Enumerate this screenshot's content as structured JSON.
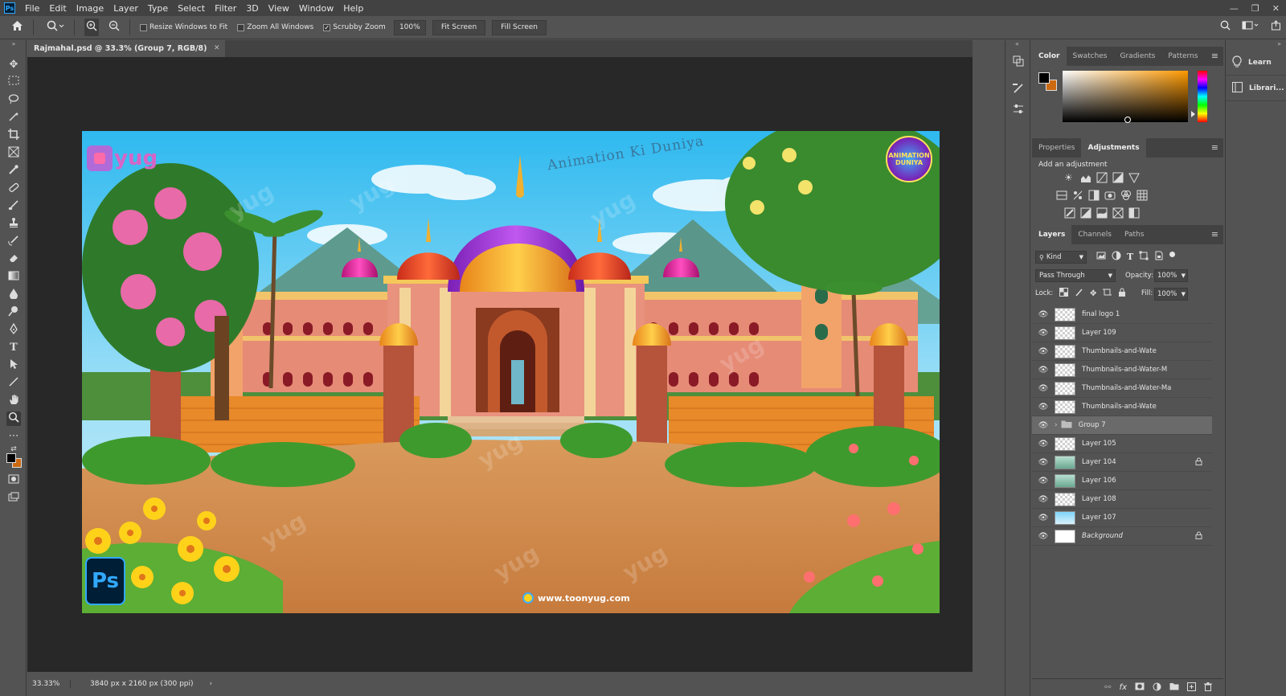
{
  "app": {
    "logo": "Ps",
    "menu": [
      "File",
      "Edit",
      "Image",
      "Layer",
      "Type",
      "Select",
      "Filter",
      "3D",
      "View",
      "Window",
      "Help"
    ],
    "window_controls": [
      "minimize-icon",
      "restore-icon",
      "close-icon"
    ]
  },
  "options": {
    "resize_windows": "Resize Windows to Fit",
    "zoom_all": "Zoom All Windows",
    "scrubby_zoom": "Scrubby Zoom",
    "zoom_value": "100%",
    "fit_screen": "Fit Screen",
    "fill_screen": "Fill Screen",
    "resize_checked": false,
    "zoom_all_checked": false,
    "scrubby_checked": true
  },
  "document": {
    "tab_title": "Rajmahal.psd @ 33.3% (Group 7, RGB/8)",
    "zoom": "33.33%",
    "doc_info": "3840 px x 2160 px (300 ppi)"
  },
  "artwork": {
    "watermark_title": "Animation Ki Duniya",
    "brand_logo": "yug",
    "corner_badge": "ANIMATION DUNIYA",
    "ps_badge": "Ps",
    "website": "www.toonyug.com"
  },
  "color_panel": {
    "tabs": [
      "Color",
      "Swatches",
      "Gradients",
      "Patterns"
    ],
    "foreground": "#000000",
    "background": "#cc6a12",
    "hue_base": "#ff9900"
  },
  "adjustments_panel": {
    "tabs": [
      "Properties",
      "Adjustments"
    ],
    "label": "Add an adjustment"
  },
  "layers_panel": {
    "tabs": [
      "Layers",
      "Channels",
      "Paths"
    ],
    "kind_label": "Kind",
    "blend_mode": "Pass Through",
    "opacity_label": "Opacity:",
    "opacity_value": "100%",
    "lock_label": "Lock:",
    "fill_label": "Fill:",
    "fill_value": "100%",
    "layers": [
      {
        "name": "final logo 1",
        "thumb": "check"
      },
      {
        "name": "Layer 109",
        "thumb": "check"
      },
      {
        "name": "Thumbnails-and-Wate",
        "thumb": "check"
      },
      {
        "name": "Thumbnails-and-Water-M",
        "thumb": "check"
      },
      {
        "name": "Thumbnails-and-Water-Ma",
        "thumb": "check"
      },
      {
        "name": "Thumbnails-and-Wate",
        "thumb": "check"
      },
      {
        "name": "Group 7",
        "thumb": "folder",
        "selected": true
      },
      {
        "name": "Layer 105",
        "thumb": "check"
      },
      {
        "name": "Layer 104",
        "thumb": "scene",
        "locked": true
      },
      {
        "name": "Layer 106",
        "thumb": "scene"
      },
      {
        "name": "Layer 108",
        "thumb": "check"
      },
      {
        "name": "Layer 107",
        "thumb": "sky"
      },
      {
        "name": "Background",
        "thumb": "white",
        "locked": true,
        "italic": true
      }
    ]
  },
  "learn_panel": {
    "learn": "Learn",
    "libraries": "Librari..."
  }
}
